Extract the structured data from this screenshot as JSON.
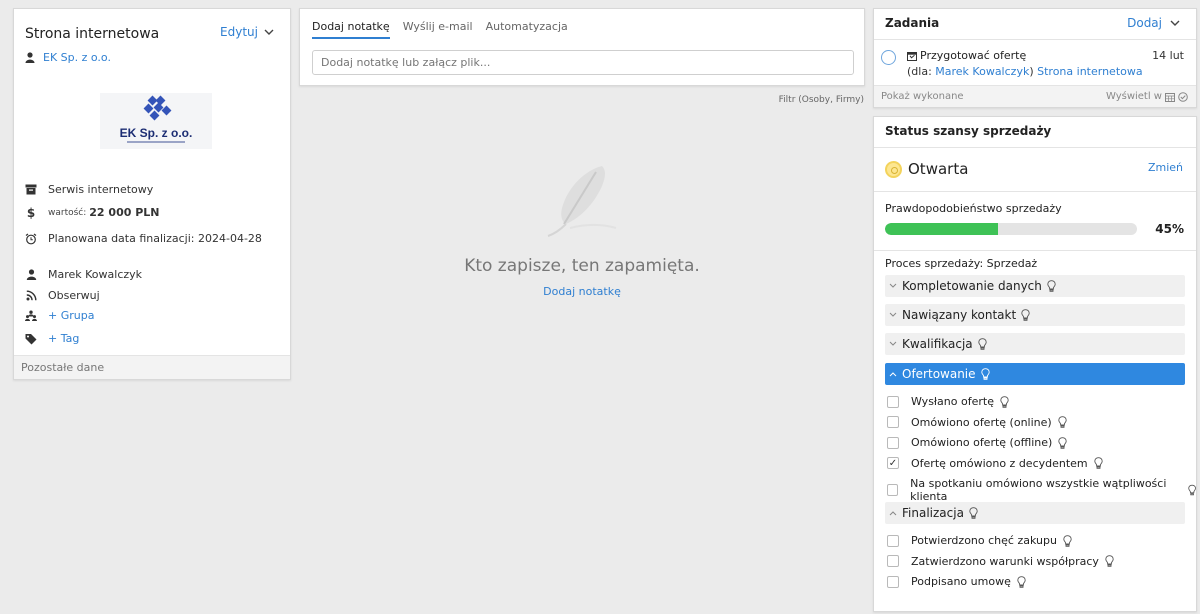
{
  "left": {
    "title": "Strona internetowa",
    "edit_label": "Edytuj",
    "company": "EK Sp. z o.o.",
    "logo_text": "EK Sp. z o.o.",
    "service": "Serwis internetowy",
    "value_label": "wartość:",
    "value": "22 000 PLN",
    "close_date": "Planowana data finalizacji: 2024-04-28",
    "owner": "Marek Kowalczyk",
    "follow": "Obserwuj",
    "group": "+ Grupa",
    "tag": "+ Tag",
    "footer": "Pozostałe dane"
  },
  "middle": {
    "tabs": [
      "Dodaj notatkę",
      "Wyślij e-mail",
      "Automatyzacja"
    ],
    "input_placeholder": "Dodaj notatkę lub załącz plik...",
    "filter": "Filtr (Osoby, Firmy)",
    "empty_text": "Kto zapisze, ten zapamięta.",
    "empty_link": "Dodaj notatkę"
  },
  "tasks": {
    "title": "Zadania",
    "add_label": "Dodaj",
    "task_title": "Przygotować ofertę",
    "task_for_prefix": "(dla: ",
    "task_person": "Marek Kowalczyk",
    "task_sep": ")",
    "task_deal": "Strona internetowa",
    "task_date": "14 lut",
    "show_done": "Pokaż wykonane",
    "show_in": "Wyświetl w"
  },
  "status": {
    "title": "Status szansy sprzedaży",
    "state": "Otwarta",
    "change": "Zmień",
    "prob_label": "Prawdopodobieństwo sprzedaży",
    "prob_value": 0.45,
    "prob_text": "45%",
    "process": "Proces sprzedaży: Sprzedaż",
    "stages": [
      "Kompletowanie danych",
      "Nawiązany kontakt",
      "Kwalifikacja",
      "Ofertowanie",
      "Finalizacja"
    ],
    "ofertowanie_items": [
      {
        "label": "Wysłano ofertę",
        "checked": false
      },
      {
        "label": "Omówiono ofertę (online)",
        "checked": false
      },
      {
        "label": "Omówiono ofertę (offline)",
        "checked": false
      },
      {
        "label": "Ofertę omówiono z decydentem",
        "checked": true
      },
      {
        "label": "Na spotkaniu omówiono wszystkie wątpliwości klienta",
        "checked": false
      }
    ],
    "finalizacja_items": [
      {
        "label": "Potwierdzono chęć zakupu",
        "checked": false
      },
      {
        "label": "Zatwierdzono warunki współpracy",
        "checked": false
      },
      {
        "label": "Podpisano umowę",
        "checked": false
      }
    ],
    "colors": {
      "accent": "#2f88e0",
      "progress": "#3ec256",
      "open_status": "#fde690"
    }
  }
}
